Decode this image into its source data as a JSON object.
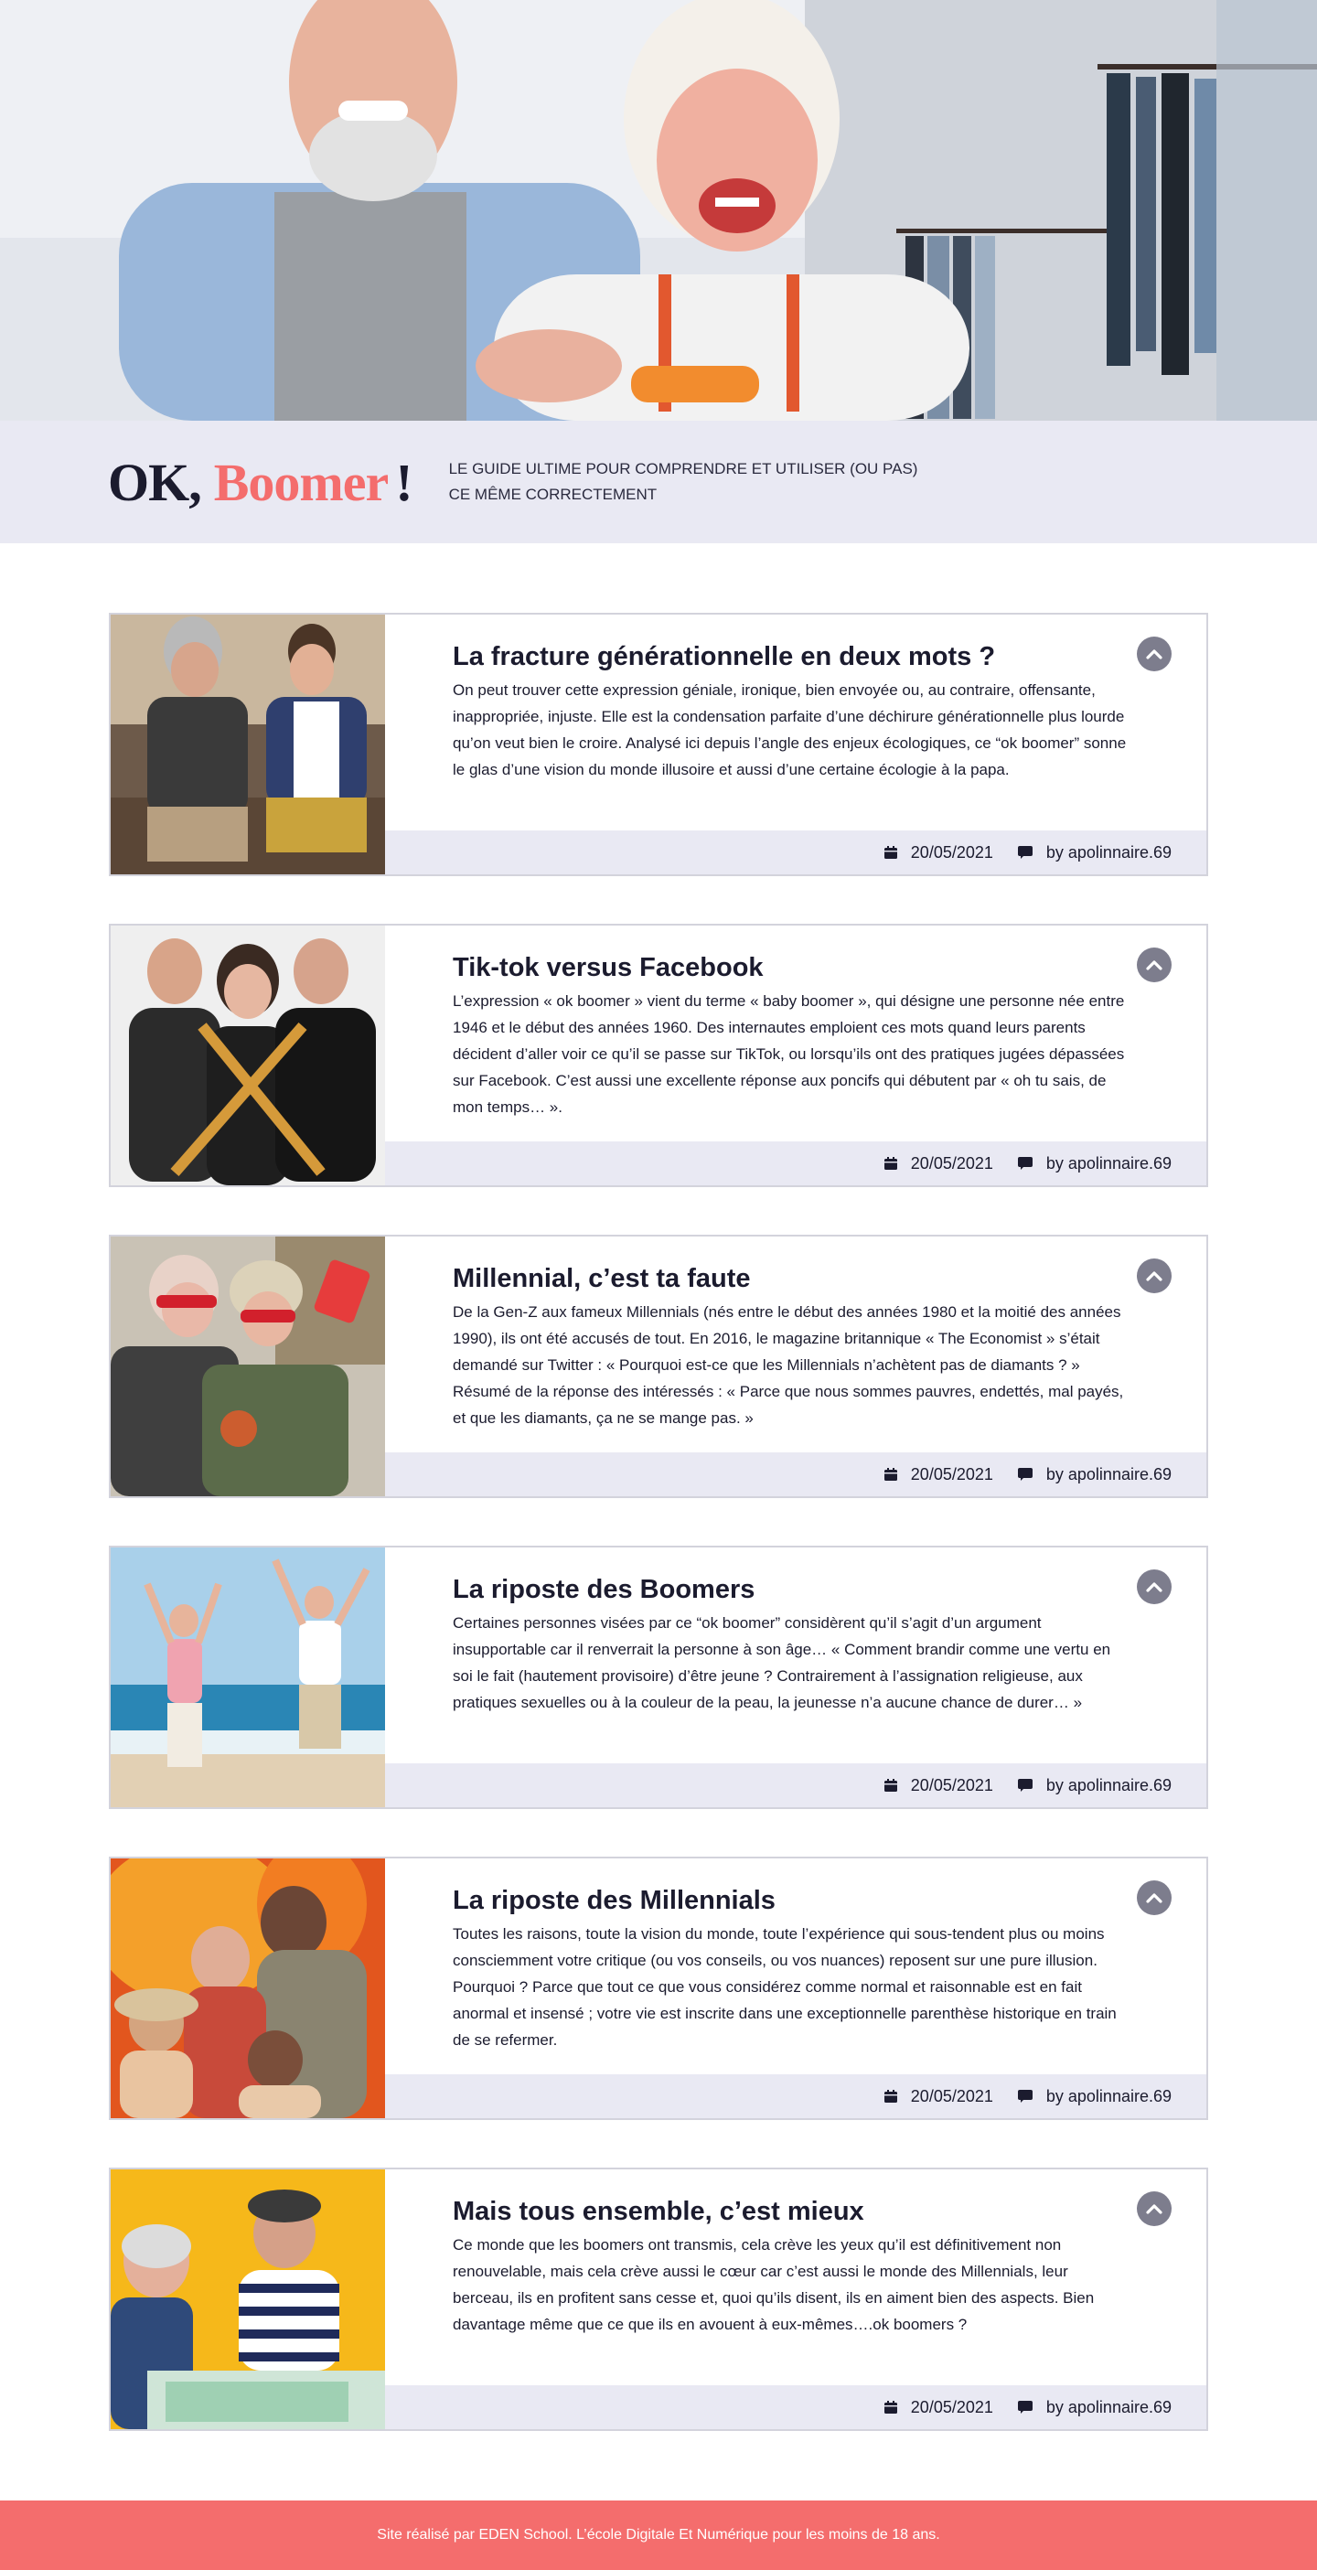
{
  "hero": {
    "image_alt": "photo-smiling-senior-couple-shopping"
  },
  "banner": {
    "logo_ok": "OK,",
    "logo_boomer": "Boomer",
    "logo_excl": "!",
    "tagline": "LE GUIDE ULTIME POUR COMPRENDRE ET UTILISER (OU PAS) CE MÊME CORRECTEMENT"
  },
  "articles": [
    {
      "title": "La fracture générationnelle en deux mots ?",
      "text": "On peut trouver cette expression géniale, ironique, bien envoyée ou, au contraire, offensante, inappropriée, injuste. Elle est la condensation parfaite d’une déchirure générationnelle plus lourde qu’on veut bien le croire. Analysé ici depuis l’angle des enjeux écologiques, ce “ok boomer” sonne le glas d’une vision du monde illusoire et aussi d’une certaine écologie à la papa.",
      "date": "20/05/2021",
      "author": "by apolinnaire.69",
      "thumb": "thumb-senior-and-young-man-on-bench"
    },
    {
      "title": "Tik-tok versus Facebook",
      "text": "L’expression « ok boomer » vient du terme « baby boomer », qui désigne une personne née entre 1946 et le début des années 1960. Des internautes emploient ces mots quand leurs parents décident d’aller voir ce qu’il se passe sur TikTok, ou lorsqu’ils ont des pratiques jugées dépassées sur Facebook. C’est aussi une excellente réponse aux poncifs qui débutent par « oh tu sais, de mon temps… ».",
      "date": "20/05/2021",
      "author": "by apolinnaire.69",
      "thumb": "thumb-three-youths-with-bats"
    },
    {
      "title": "Millennial, c’est ta faute",
      "text": "De la Gen-Z aux fameux Millennials (nés entre le début des années 1980 et la moitié des années 1990), ils ont été accusés de tout. En 2016, le magazine britannique « The Economist » s’était demandé sur Twitter : « Pourquoi est-ce que les Millennials n’achètent pas de diamants ? » Résumé de la réponse des intéressés : « Parce que nous sommes pauvres, endettés, mal payés, et que les diamants, ça ne se mange pas. »",
      "date": "20/05/2021",
      "author": "by apolinnaire.69",
      "thumb": "thumb-senior-women-selfie"
    },
    {
      "title": "La riposte des Boomers",
      "text": "Certaines personnes visées par ce “ok boomer” considèrent qu’il s’agit d’un argument insupportable car il renverrait la personne à son âge… « Comment brandir comme une vertu en soi le fait (hautement provisoire) d’être jeune ? Contrairement à l’assignation religieuse, aux pratiques sexuelles ou à la couleur de la peau, la jeunesse n’a aucune chance de durer… »",
      "date": "20/05/2021",
      "author": "by apolinnaire.69",
      "thumb": "thumb-seniors-jumping-on-beach"
    },
    {
      "title": "La riposte des Millennials",
      "text": "Toutes les raisons, toute la vision du monde, toute l’expérience qui sous-tendent plus ou moins consciemment votre critique (ou vos conseils, ou vos nuances) reposent sur une pure illusion. Pourquoi ? Parce que tout ce que vous considérez comme normal et raisonnable est en fait anormal et insensé ; votre vie est inscrite dans une exceptionnelle parenthèse historique en train de se refermer.",
      "date": "20/05/2021",
      "author": "by apolinnaire.69",
      "thumb": "thumb-seniors-in-front-of-fire"
    },
    {
      "title": "Mais tous ensemble, c’est mieux",
      "text": "Ce monde que les boomers ont transmis, cela crève les yeux qu’il est définitivement non renouvelable, mais cela crève aussi le cœur car c’est aussi le monde des Millennials, leur berceau, ils en profitent sans cesse et, quoi qu’ils disent, ils en aiment bien des aspects. Bien davantage même que ce que ils en avouent à eux-mêmes….ok boomers ?",
      "date": "20/05/2021",
      "author": "by apolinnaire.69",
      "thumb": "thumb-senior-and-young-man-board-game"
    }
  ],
  "icons": {
    "toggle": "chevron-up-icon",
    "date": "calendar-icon",
    "author": "comment-icon"
  },
  "colors": {
    "accent": "#f46d6d",
    "dark": "#1b1b2e",
    "band": "#e9e9f3",
    "toggle": "#7d7d8d"
  },
  "footer": {
    "text": "Site réalisé par EDEN School. L’école Digitale Et Numérique pour les moins de 18 ans."
  }
}
